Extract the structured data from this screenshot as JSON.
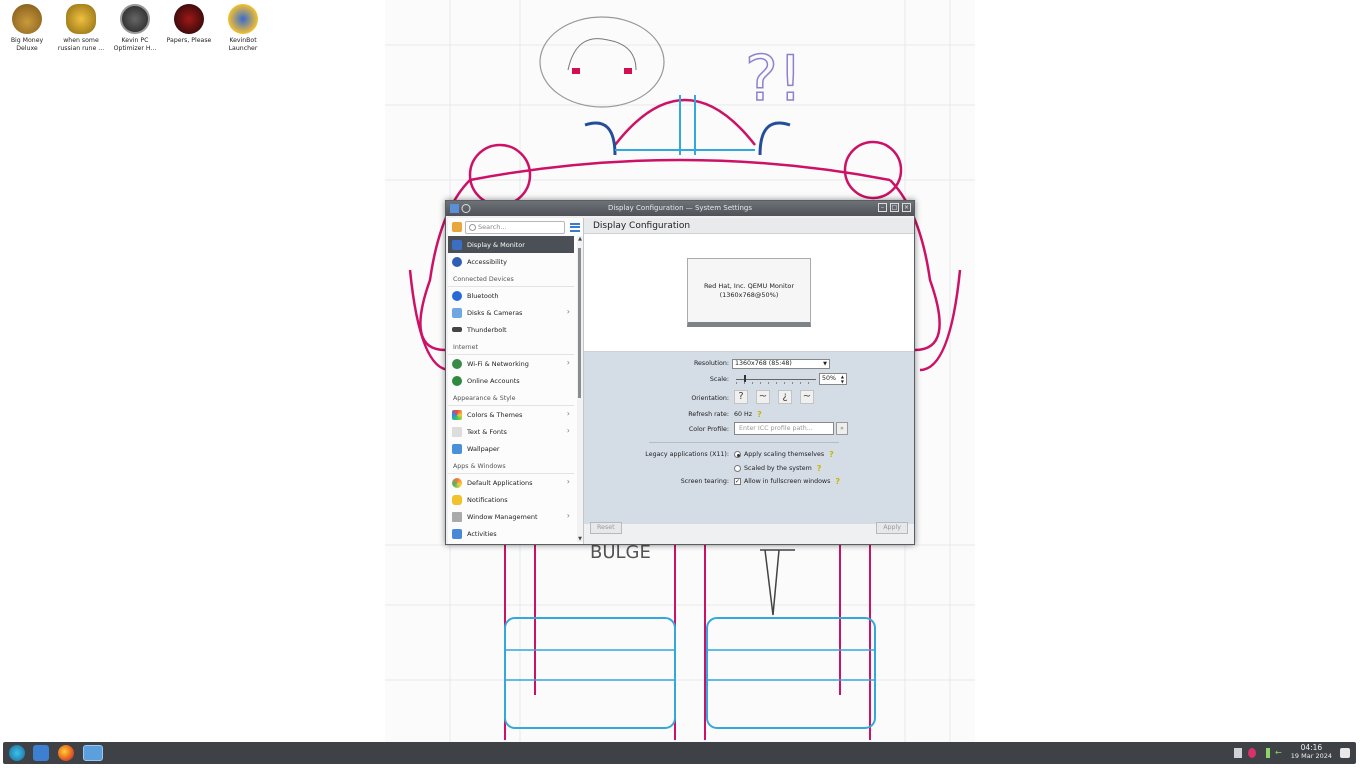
{
  "desktop": {
    "icons": [
      {
        "label": "Big Money Deluxe",
        "icon": "money-bag-icon"
      },
      {
        "label": "when some russian rune ...",
        "icon": "gear-crown-icon"
      },
      {
        "label": "Kevin PC Optimizer H...",
        "icon": "speedometer-icon"
      },
      {
        "label": "Papers, Please",
        "icon": "papers-please-icon"
      },
      {
        "label": "KevinBot Launcher",
        "icon": "kevinbot-icon"
      }
    ],
    "wallpaper_text": {
      "bulge": "BULGE",
      "question": "?!"
    }
  },
  "window": {
    "title": "Display Configuration — System Settings",
    "controls": [
      "minimize",
      "maximize",
      "close"
    ]
  },
  "sidebar": {
    "search_placeholder": "Search...",
    "sections": [
      {
        "header": "",
        "items": [
          {
            "label": "Display & Monitor",
            "icon": "display-icon",
            "active": true
          },
          {
            "label": "Accessibility",
            "icon": "accessibility-icon"
          }
        ]
      },
      {
        "header": "Connected Devices",
        "items": [
          {
            "label": "Bluetooth",
            "icon": "bluetooth-icon"
          },
          {
            "label": "Disks & Cameras",
            "icon": "disks-icon",
            "chevron": true
          },
          {
            "label": "Thunderbolt",
            "icon": "thunderbolt-icon"
          }
        ]
      },
      {
        "header": "Internet",
        "items": [
          {
            "label": "Wi-Fi & Networking",
            "icon": "network-icon",
            "chevron": true
          },
          {
            "label": "Online Accounts",
            "icon": "online-accounts-icon"
          }
        ]
      },
      {
        "header": "Appearance & Style",
        "items": [
          {
            "label": "Colors & Themes",
            "icon": "colors-icon",
            "chevron": true
          },
          {
            "label": "Text & Fonts",
            "icon": "fonts-icon",
            "chevron": true
          },
          {
            "label": "Wallpaper",
            "icon": "wallpaper-icon"
          }
        ]
      },
      {
        "header": "Apps & Windows",
        "items": [
          {
            "label": "Default Applications",
            "icon": "default-apps-icon",
            "chevron": true
          },
          {
            "label": "Notifications",
            "icon": "notifications-icon"
          },
          {
            "label": "Window Management",
            "icon": "window-management-icon",
            "chevron": true
          },
          {
            "label": "Activities",
            "icon": "activities-icon"
          }
        ]
      }
    ]
  },
  "main": {
    "title": "Display Configuration",
    "monitor_name": "Red Hat, Inc. QEMU Monitor",
    "monitor_mode": "(1360x768@50%)",
    "resolution_label": "Resolution:",
    "resolution_value": "1360x768 (85:48)",
    "scale_label": "Scale:",
    "scale_value": "50%",
    "scale_fraction": 0.1,
    "orientation_label": "Orientation:",
    "refresh_label": "Refresh rate:",
    "refresh_value": "60 Hz",
    "color_profile_label": "Color Profile:",
    "color_profile_placeholder": "Enter ICC profile path...",
    "legacy_label": "Legacy applications (X11):",
    "legacy_option1": "Apply scaling themselves",
    "legacy_option2": "Scaled by the system",
    "tearing_label": "Screen tearing:",
    "tearing_option": "Allow in fullscreen windows",
    "reset_button": "Reset",
    "apply_button": "Apply"
  },
  "taskbar": {
    "apps": [
      "app-launcher-icon",
      "file-manager-icon",
      "firefox-icon",
      "system-settings-icon"
    ],
    "time": "04:16",
    "date": "19 Mar 2024"
  }
}
